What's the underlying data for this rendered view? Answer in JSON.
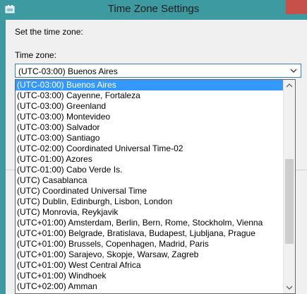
{
  "window": {
    "title": "Time Zone Settings"
  },
  "dialog": {
    "instruction": "Set the time zone:",
    "timezone_label": "Time zone:",
    "selected_value": "(UTC-03:00) Buenos Aires"
  },
  "dropdown": {
    "items": [
      "(UTC-03:00) Buenos Aires",
      "(UTC-03:00) Cayenne, Fortaleza",
      "(UTC-03:00) Greenland",
      "(UTC-03:00) Montevideo",
      "(UTC-03:00) Salvador",
      "(UTC-03:00) Santiago",
      "(UTC-02:00) Coordinated Universal Time-02",
      "(UTC-01:00) Azores",
      "(UTC-01:00) Cabo Verde Is.",
      "(UTC) Casablanca",
      "(UTC) Coordinated Universal Time",
      "(UTC) Dublin, Edinburgh, Lisbon, London",
      "(UTC) Monrovia, Reykjavik",
      "(UTC+01:00) Amsterdam, Berlin, Bern, Rome, Stockholm, Vienna",
      "(UTC+01:00) Belgrade, Bratislava, Budapest, Ljubljana, Prague",
      "(UTC+01:00) Brussels, Copenhagen, Madrid, Paris",
      "(UTC+01:00) Sarajevo, Skopje, Warsaw, Zagreb",
      "(UTC+01:00) West Central Africa",
      "(UTC+01:00) Windhoek",
      "(UTC+02:00) Amman"
    ]
  },
  "colors": {
    "frame": "#3d9aa0",
    "selection": "#3399ff",
    "close": "#c7504a"
  }
}
